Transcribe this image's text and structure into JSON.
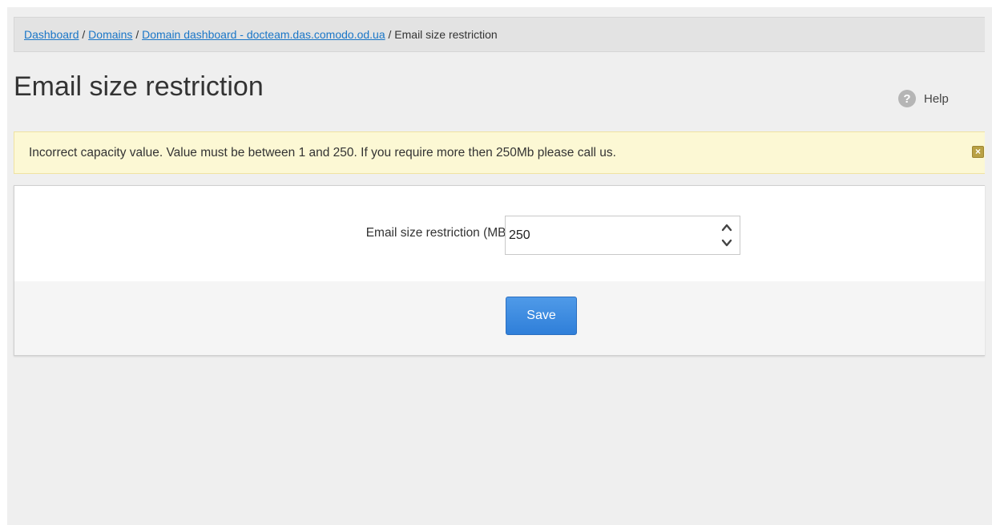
{
  "breadcrumb": {
    "items": [
      {
        "label": "Dashboard",
        "link": true
      },
      {
        "label": "Domains",
        "link": true
      },
      {
        "label": "Domain dashboard - docteam.das.comodo.od.ua",
        "link": true
      },
      {
        "label": "Email size restriction",
        "link": false
      }
    ],
    "separator": "/"
  },
  "page": {
    "title": "Email size restriction"
  },
  "help": {
    "icon_glyph": "?",
    "icon": "help-circle-icon",
    "label": "Help"
  },
  "alert": {
    "message": "Incorrect capacity value. Value must be between 1 and 250. If you require more then 250Mb please call us.",
    "close_icon": "close-icon",
    "close_glyph": "×",
    "background_color": "#fcf8d4"
  },
  "form": {
    "field_label": "Email size restriction (MB):",
    "field_value": "250",
    "save_label": "Save",
    "accent_color": "#2f7fd9"
  }
}
